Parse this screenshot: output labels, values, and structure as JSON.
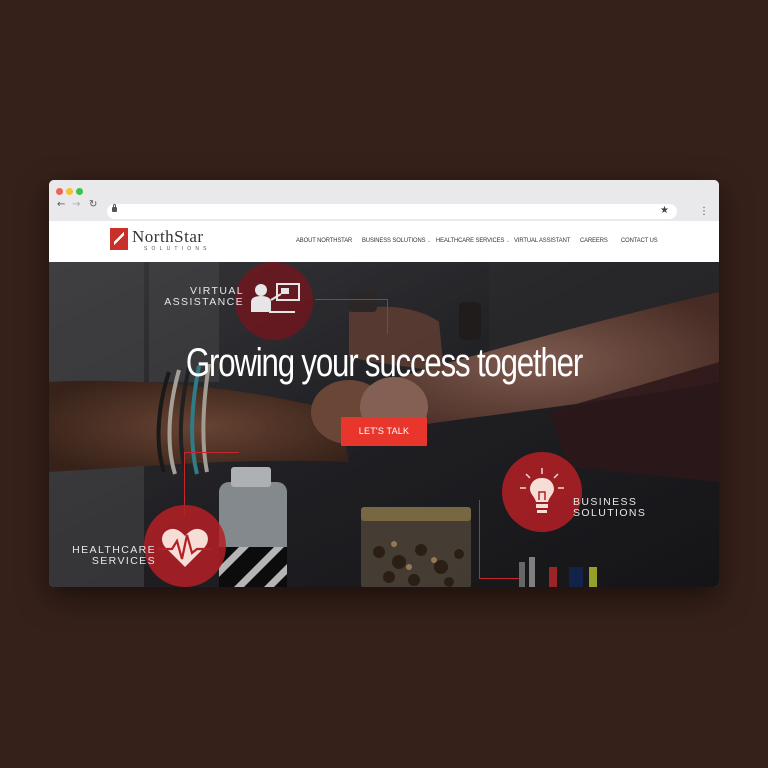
{
  "site": {
    "logo_word": "NorthStar",
    "logo_sub": "SOLUTIONS"
  },
  "nav": {
    "items": [
      {
        "label": "ABOUT NORTHSTAR",
        "dropdown": false
      },
      {
        "label": "BUSINESS SOLUTIONS",
        "dropdown": true
      },
      {
        "label": "HEALTHCARE SERVICES",
        "dropdown": true
      },
      {
        "label": "VIRTUAL ASSISTANT",
        "dropdown": false
      },
      {
        "label": "CAREERS",
        "dropdown": false
      },
      {
        "label": "CONTACT US",
        "dropdown": false
      }
    ]
  },
  "hero": {
    "title": "Growing your success together",
    "cta_label": "LET'S TALK"
  },
  "badges": {
    "virtual": {
      "line1": "VIRTUAL",
      "line2": "ASSISTANCE",
      "icon": "presenter-icon"
    },
    "business": {
      "line1": "BUSINESS",
      "line2": "SOLUTIONS",
      "icon": "lightbulb-icon"
    },
    "healthcare": {
      "line1": "HEALTHCARE",
      "line2": "SERVICES",
      "icon": "heartbeat-icon"
    }
  },
  "colors": {
    "page_bg": "#36201a",
    "accent": "#e8362d",
    "badge_red": "#b42026"
  }
}
